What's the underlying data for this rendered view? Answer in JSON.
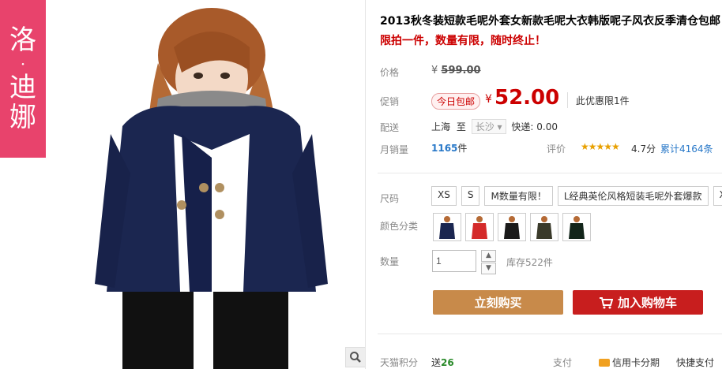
{
  "brand": {
    "chars": [
      "洛",
      "·",
      "迪",
      "娜"
    ],
    "color": "#e8436c"
  },
  "product": {
    "title": "2013秋冬装短款毛呢外套女新款毛呢大衣韩版呢子风衣反季清仓包邮",
    "subtitle": "限拍一件，数量有限，随时终止！"
  },
  "price": {
    "label": "价格",
    "currency": "¥",
    "original": "599.00",
    "promo_label": "促销",
    "free_ship_badge": "今日包邮",
    "current": "52.00",
    "promo_note": "此优惠限1件"
  },
  "shipping": {
    "label": "配送",
    "from": "上海",
    "to_word": "至",
    "to": "长沙",
    "fee_text": "快递: 0.00"
  },
  "sales": {
    "label": "月销量",
    "count": "1165",
    "unit": "件",
    "review_label": "评价",
    "stars": "★★★★★",
    "score": "4.7分",
    "reviews": "累计4164条"
  },
  "options": {
    "size_label": "尺码",
    "sizes": [
      "XS",
      "S",
      "M数量有限！",
      "L经典英伦风格短装毛呢外套爆款",
      "XL"
    ],
    "color_label": "颜色分类",
    "colors": [
      "#1b2650",
      "#d42a2a",
      "#1a1a1a",
      "#3a3a2a",
      "#12251a"
    ],
    "qty_label": "数量",
    "qty_value": "1",
    "stock": "库存522件"
  },
  "actions": {
    "buy_now": "立刻购买",
    "add_cart": "加入购物车"
  },
  "footer": {
    "points_label": "天猫积分",
    "points_prefix": "送",
    "points_value": "26",
    "pay_label": "支付",
    "credit": "信用卡分期",
    "quick_pay": "快捷支付"
  }
}
